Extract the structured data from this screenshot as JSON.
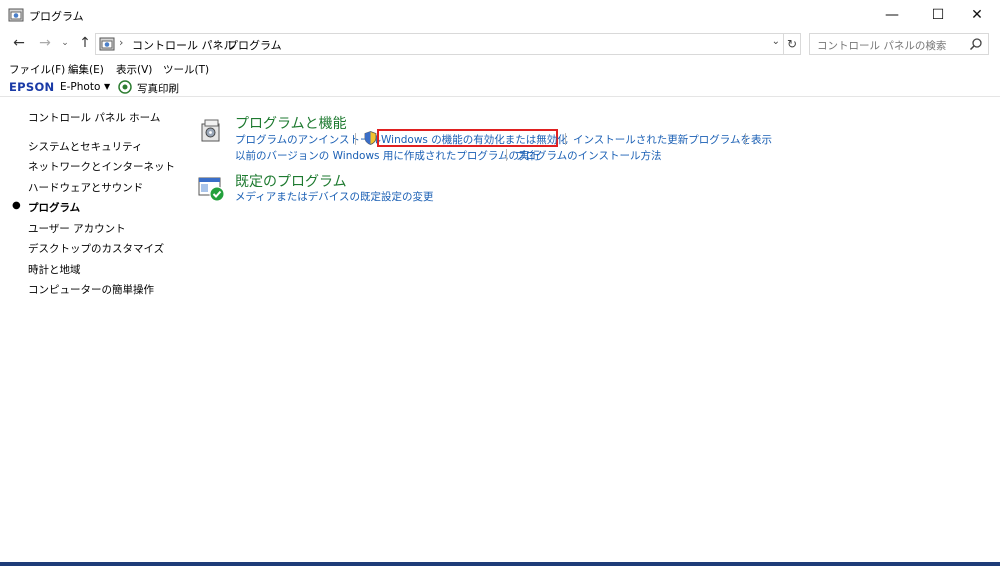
{
  "window": {
    "title": "プログラム"
  },
  "window_buttons": {
    "minimize": "—",
    "maximize": "☐",
    "close": "✕"
  },
  "address": {
    "crumbs": [
      "コントロール パネル",
      "プログラム"
    ],
    "search_placeholder": "コントロール パネルの検索"
  },
  "menu": [
    "ファイル(F)",
    "編集(E)",
    "表示(V)",
    "ツール(T)"
  ],
  "epson": {
    "logo": "EPSON",
    "app": "E-Photo",
    "print": "写真印刷"
  },
  "sidebar": {
    "home": "コントロール パネル ホーム",
    "items": [
      "システムとセキュリティ",
      "ネットワークとインターネット",
      "ハードウェアとサウンド",
      "プログラム",
      "ユーザー アカウント",
      "デスクトップのカスタマイズ",
      "時計と地域",
      "コンピューターの簡単操作"
    ],
    "active_index": 3
  },
  "categories": [
    {
      "title": "プログラムと機能",
      "links": [
        "プログラムのアンインストール",
        "Windows の機能の有効化または無効化",
        "インストールされた更新プログラムを表示",
        "以前のバージョンの Windows 用に作成されたプログラムの実行",
        "プログラムのインストール方法"
      ]
    },
    {
      "title": "既定のプログラム",
      "links": [
        "メディアまたはデバイスの既定設定の変更"
      ]
    }
  ],
  "colors": {
    "link": "#1a5fb4",
    "category_title": "#1e7a30",
    "highlight": "#e02020"
  }
}
